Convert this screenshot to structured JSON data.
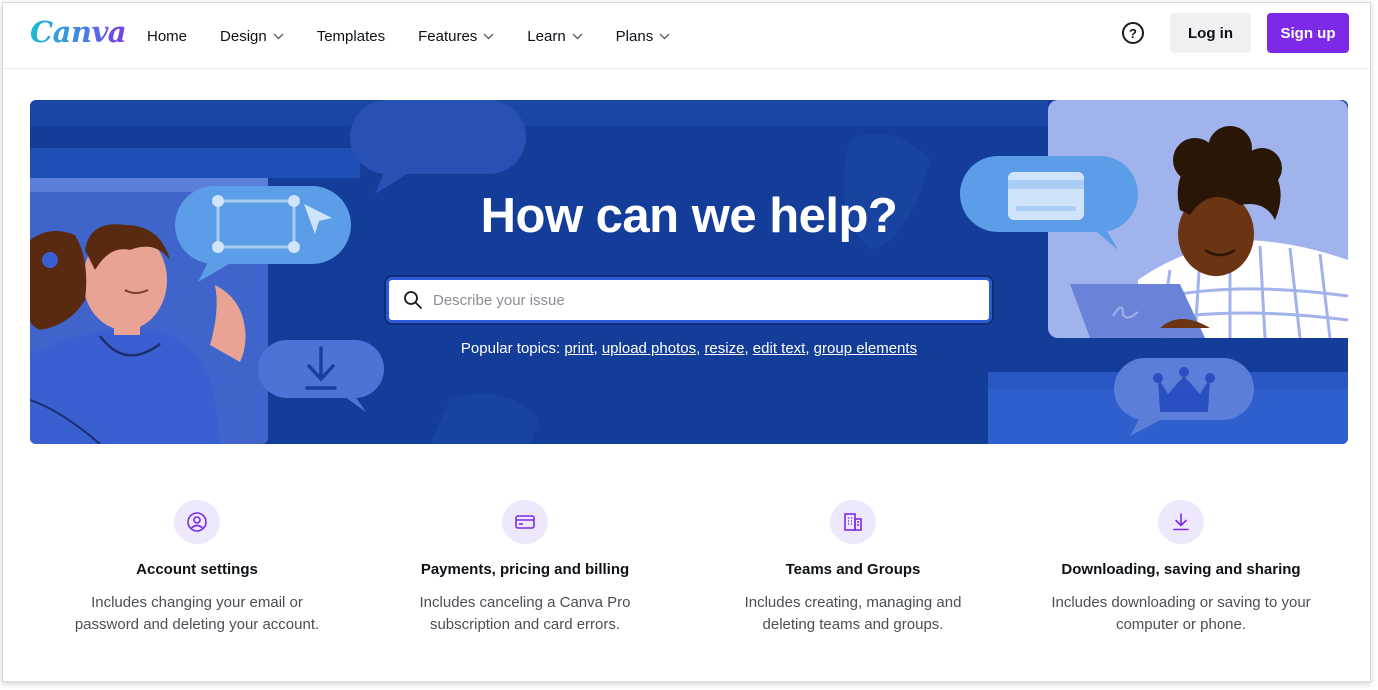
{
  "header": {
    "logo": "Canva",
    "nav": [
      {
        "label": "Home",
        "dropdown": false
      },
      {
        "label": "Design",
        "dropdown": true
      },
      {
        "label": "Templates",
        "dropdown": false
      },
      {
        "label": "Features",
        "dropdown": true
      },
      {
        "label": "Learn",
        "dropdown": true
      },
      {
        "label": "Plans",
        "dropdown": true
      }
    ],
    "help_icon": "?",
    "login_label": "Log in",
    "signup_label": "Sign up"
  },
  "hero": {
    "title": "How can we help?",
    "search_placeholder": "Describe your issue",
    "search_value": "",
    "popular_label": "Popular topics:",
    "popular_topics": [
      "print",
      "upload photos",
      "resize",
      "edit text",
      "group elements"
    ]
  },
  "categories": [
    {
      "icon": "user-circle-icon",
      "title": "Account settings",
      "desc_line1": "Includes changing your email or",
      "desc_line2": "password and deleting your account."
    },
    {
      "icon": "credit-card-icon",
      "title": "Payments, pricing and billing",
      "desc_line1": "Includes canceling a Canva Pro",
      "desc_line2": "subscription and card errors."
    },
    {
      "icon": "building-icon",
      "title": "Teams and Groups",
      "desc_line1": "Includes creating, managing and",
      "desc_line2": "deleting teams and groups."
    },
    {
      "icon": "download-icon",
      "title": "Downloading, saving and sharing",
      "desc_line1": "Includes downloading or saving to your",
      "desc_line2": "computer or phone."
    }
  ],
  "colors": {
    "brand_purple": "#7d2ae8",
    "hero_blue": "#143d99",
    "icon_purple": "#7d2ae8"
  }
}
